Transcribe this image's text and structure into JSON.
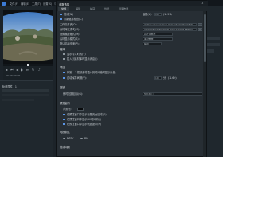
{
  "menubar": {
    "items": [
      "文件(F)",
      "编辑(E)",
      "工具(T)",
      "设置(S)",
      "帮助(H)"
    ]
  },
  "dialog": {
    "title": "参数选择",
    "tabs": [
      "常规",
      "编辑",
      "捕获",
      "性能",
      "界面布局"
    ],
    "rows": {
      "undo": {
        "label": "撤消(N)",
        "level_label": "级数(L):",
        "level_value": "10",
        "range": "(1..99)"
      },
      "reload_chapters": {
        "label": "重新链接检查(C)"
      },
      "work_folder": {
        "label": "工作文件夹(O):",
        "value": "sk\\Documents\\Corel VideoStudio Pro\\23.0\\"
      },
      "media_folder": {
        "label": "素材库文件夹(M):",
        "value": "nts\\Corel VideoStudio Pro\\23.0\\WorkSettin"
      },
      "playback_format": {
        "label": "音频播放格式(M):",
        "value": "基于源格式"
      },
      "clip_conform": {
        "label": "素材显示模式(S):",
        "value": "素材数量"
      },
      "default_trim": {
        "label": "默认启动页面(P):",
        "value": "编辑"
      },
      "media": {
        "label": "媒体"
      },
      "smart_proxy": {
        "label": "显示导入时的(Y)"
      },
      "auto_insert": {
        "label": "插入到素材库时显示消息(I)"
      },
      "project": {
        "label": "项目"
      },
      "insert_preview": {
        "label": "将第一个视频素材插入到时间轴时显示消息"
      },
      "auto_save": {
        "label": "自动保存间隔(V):",
        "value": "10",
        "unit": "分",
        "range": "(1..60)"
      },
      "replay": {
        "label": "回放"
      },
      "instant_play_target": {
        "label": "即时回放目标(G):",
        "value": "预览窗口"
      },
      "preview_window": {
        "label": "预览窗口"
      },
      "bg_color": {
        "label": "背景色:"
      },
      "title_safe": {
        "label": "在预览窗口中显示标题安全区域(D)"
      },
      "dv_timecode": {
        "label": "在预览窗口中显示DV时间码(I)"
      },
      "track_mark": {
        "label": "在预览窗口中显示轨道提示(R)"
      },
      "video_format": {
        "label": "电视制式"
      },
      "ntsc": {
        "label": "NTSC"
      },
      "pal": {
        "label": "PAL"
      },
      "interval": {
        "label": "撤消间隔"
      }
    },
    "ellipsis": "..."
  },
  "preview": {
    "timecode": "00:00:00:00"
  },
  "leftpanel": {
    "header": "轨道属性 - 1"
  },
  "rightstrip": {
    "label": "HD"
  },
  "colors": {
    "accent": "#3c7bd6",
    "dialog_bg": "#272e34",
    "app_bg": "#1c2329"
  }
}
